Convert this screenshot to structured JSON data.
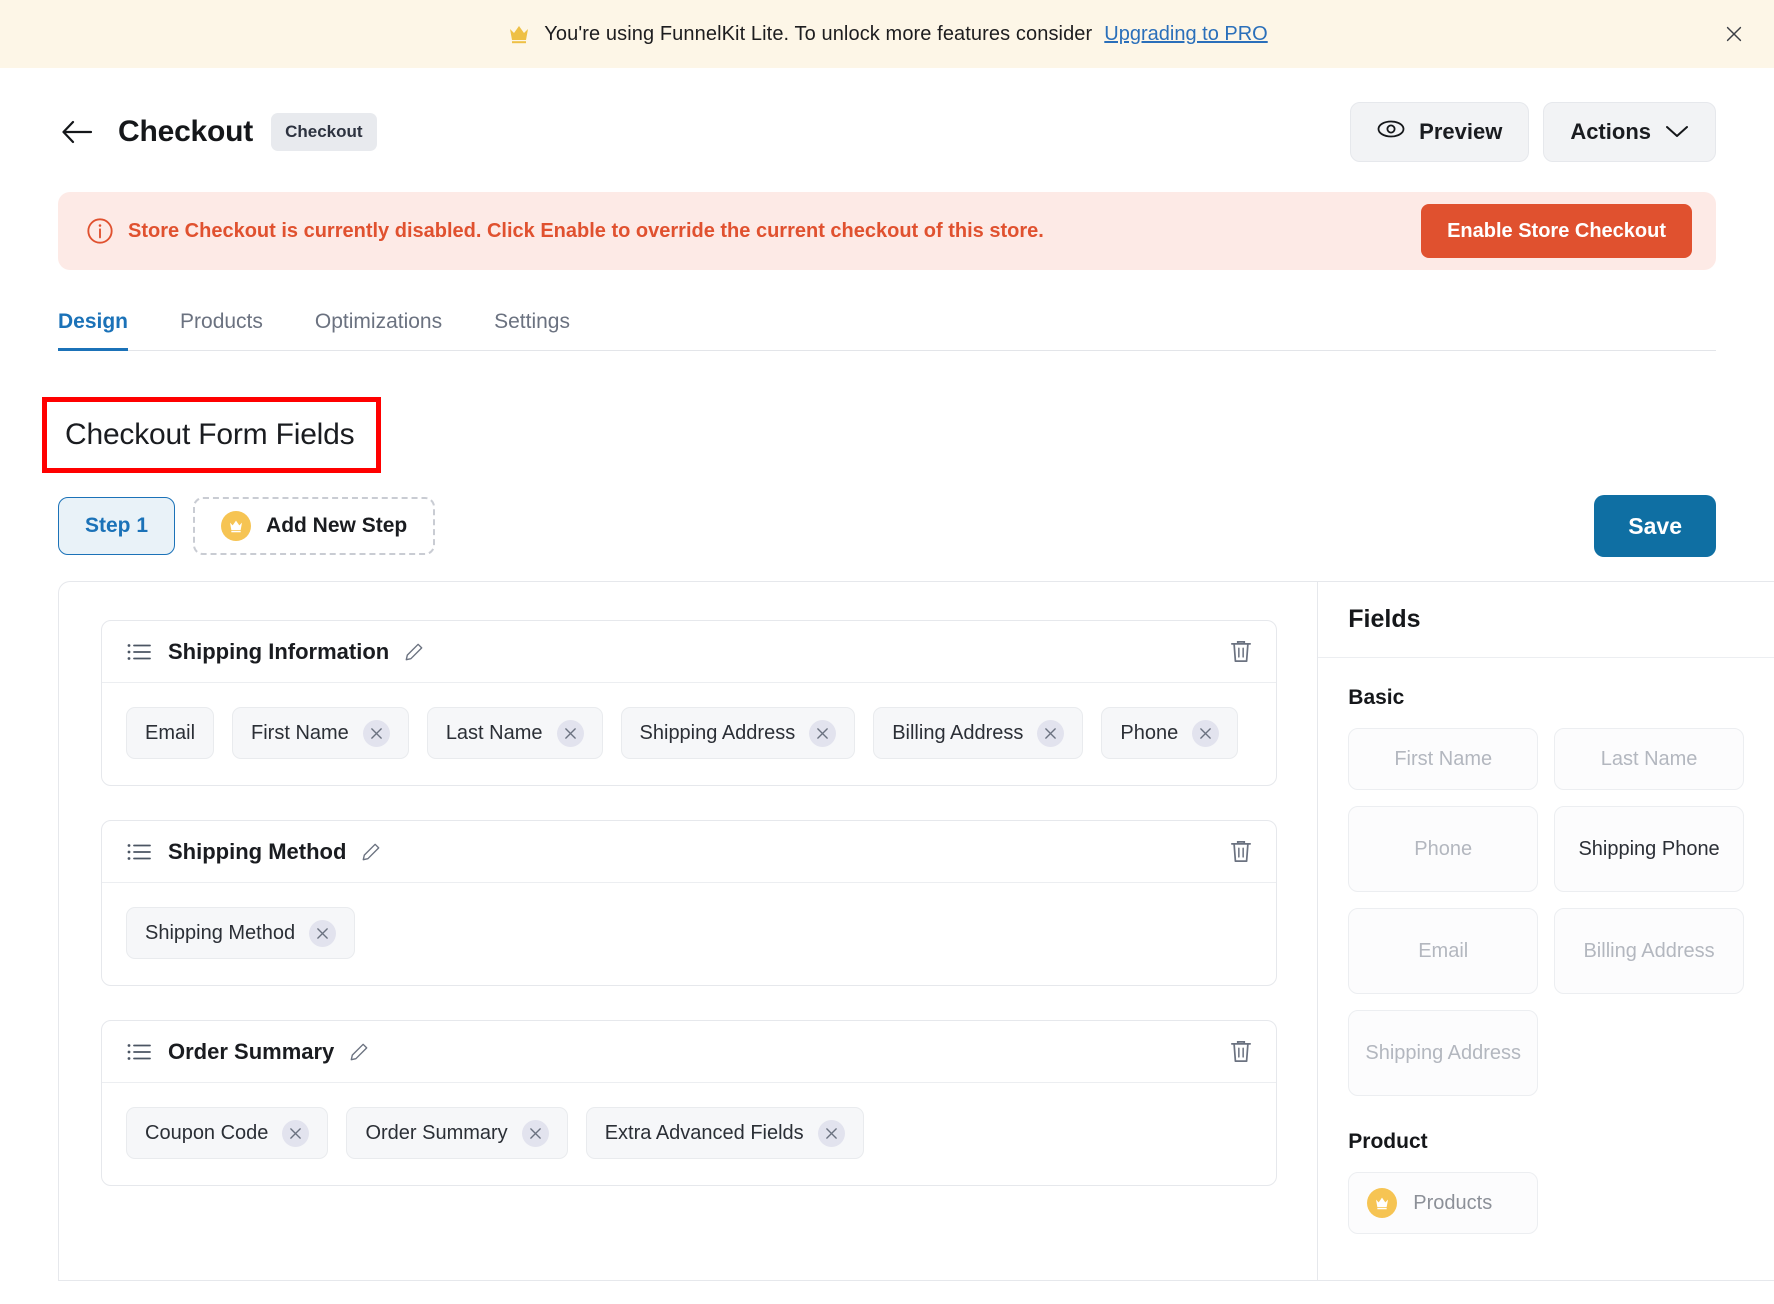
{
  "promo": {
    "icon": "crown-icon",
    "text_before": "You're using FunnelKit Lite. To unlock more features consider ",
    "link_label": "Upgrading to PRO",
    "close_icon": "close-icon"
  },
  "header": {
    "back_icon": "arrow-left-icon",
    "title": "Checkout",
    "chip": "Checkout",
    "preview_label": "Preview",
    "preview_icon": "eye-icon",
    "actions_label": "Actions",
    "actions_icon": "chevron-down-icon"
  },
  "notice": {
    "icon": "info-circle-icon",
    "message": "Store Checkout is currently disabled. Click Enable to override the current checkout of this store.",
    "button_label": "Enable Store Checkout",
    "accent_color": "#e0512f",
    "background_color": "#fdeae6"
  },
  "tabs": [
    {
      "label": "Design",
      "active": true
    },
    {
      "label": "Products",
      "active": false
    },
    {
      "label": "Optimizations",
      "active": false
    },
    {
      "label": "Settings",
      "active": false
    }
  ],
  "section": {
    "heading": "Checkout Form Fields",
    "annotation_color": "#ff0000"
  },
  "steps": {
    "step_label": "Step 1",
    "add_label": "Add New Step",
    "add_icon": "crown-icon",
    "save_label": "Save",
    "save_color": "#0f6fa3"
  },
  "builder": {
    "sections": [
      {
        "title": "Shipping Information",
        "drag_icon": "list-drag-icon",
        "edit_icon": "pencil-icon",
        "delete_icon": "trash-icon",
        "chips": [
          {
            "label": "Email",
            "removable": false
          },
          {
            "label": "First Name",
            "removable": true
          },
          {
            "label": "Last Name",
            "removable": true
          },
          {
            "label": "Shipping Address",
            "removable": true
          },
          {
            "label": "Billing Address",
            "removable": true
          },
          {
            "label": "Phone",
            "removable": true
          }
        ]
      },
      {
        "title": "Shipping Method",
        "drag_icon": "list-drag-icon",
        "edit_icon": "pencil-icon",
        "delete_icon": "trash-icon",
        "chips": [
          {
            "label": "Shipping Method",
            "removable": true
          }
        ]
      },
      {
        "title": "Order Summary",
        "drag_icon": "list-drag-icon",
        "edit_icon": "pencil-icon",
        "delete_icon": "trash-icon",
        "chips": [
          {
            "label": "Coupon Code",
            "removable": true
          },
          {
            "label": "Order Summary",
            "removable": true
          },
          {
            "label": "Extra Advanced Fields",
            "removable": true
          }
        ]
      }
    ]
  },
  "fields_panel": {
    "title": "Fields",
    "groups": [
      {
        "label": "Basic",
        "tiles": [
          {
            "label": "First Name",
            "available": false,
            "two_line": false,
            "pro": false
          },
          {
            "label": "Last Name",
            "available": false,
            "two_line": false,
            "pro": false
          },
          {
            "label": "Phone",
            "available": false,
            "two_line": true,
            "pro": false
          },
          {
            "label": "Shipping Phone",
            "available": true,
            "two_line": true,
            "pro": false
          },
          {
            "label": "Email",
            "available": false,
            "two_line": true,
            "pro": false
          },
          {
            "label": "Billing Address",
            "available": false,
            "two_line": true,
            "pro": false
          },
          {
            "label": "Shipping Address",
            "available": false,
            "two_line": true,
            "pro": false
          }
        ]
      },
      {
        "label": "Product",
        "tiles": [
          {
            "label": "Products",
            "available": false,
            "two_line": false,
            "pro": true,
            "icon": "crown-icon"
          }
        ]
      }
    ]
  }
}
